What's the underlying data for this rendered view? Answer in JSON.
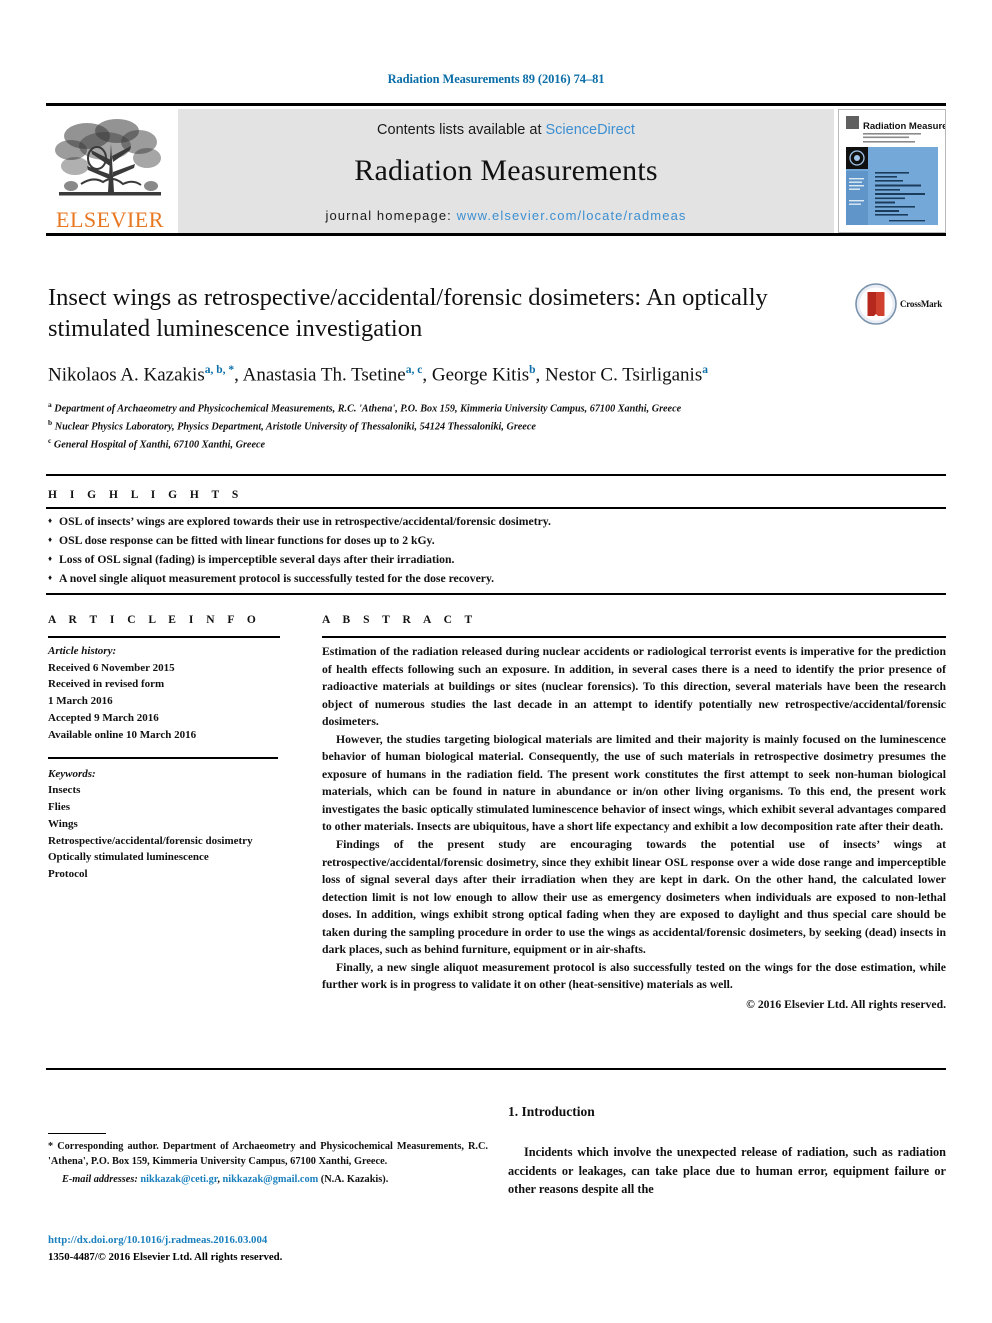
{
  "running_head": "Radiation Measurements 89 (2016) 74–81",
  "masthead": {
    "contents_prefix": "Contents lists available at ",
    "sciencedirect": "ScienceDirect",
    "journal_name": "Radiation Measurements",
    "homepage_prefix": "journal homepage: ",
    "homepage_url": "www.elsevier.com/locate/radmeas",
    "publisher": "ELSEVIER",
    "publisher_color": "#E87722",
    "link_color": "#3d8fd1",
    "band_color": "#e3e3e3",
    "cover_title": "Radiation Measurements"
  },
  "article": {
    "title": "Insect wings as retrospective/accidental/forensic dosimeters: An optically stimulated luminescence investigation",
    "authors": [
      {
        "name": "Nikolaos A. Kazakis",
        "marks": "a, b, *"
      },
      {
        "name": "Anastasia Th. Tsetine",
        "marks": "a, c"
      },
      {
        "name": "George Kitis",
        "marks": "b"
      },
      {
        "name": "Nestor C. Tsirliganis",
        "marks": "a"
      }
    ],
    "affiliations": [
      {
        "mark": "a",
        "text": "Department of Archaeometry and Physicochemical Measurements, R.C. 'Athena', P.O. Box 159, Kimmeria University Campus, 67100 Xanthi, Greece"
      },
      {
        "mark": "b",
        "text": "Nuclear Physics Laboratory, Physics Department, Aristotle University of Thessaloniki, 54124 Thessaloniki, Greece"
      },
      {
        "mark": "c",
        "text": "General Hospital of Xanthi, 67100 Xanthi, Greece"
      }
    ]
  },
  "crossmark": {
    "label": "CrossMark"
  },
  "highlights": {
    "heading": "H I G H L I G H T S",
    "items": [
      "OSL of insects’ wings are explored towards their use in retrospective/accidental/forensic dosimetry.",
      "OSL dose response can be fitted with linear functions for doses up to 2 kGy.",
      "Loss of OSL signal (fading) is imperceptible several days after their irradiation.",
      "A novel single aliquot measurement protocol is successfully tested for the dose recovery."
    ]
  },
  "article_info": {
    "heading": "A R T I C L E   I N F O",
    "history_label": "Article history:",
    "history": [
      "Received 6 November 2015",
      "Received in revised form",
      "1 March 2016",
      "Accepted 9 March 2016",
      "Available online 10 March 2016"
    ],
    "keywords_label": "Keywords:",
    "keywords": [
      "Insects",
      "Flies",
      "Wings",
      "Retrospective/accidental/forensic dosimetry",
      "Optically stimulated luminescence",
      "Protocol"
    ]
  },
  "abstract": {
    "heading": "A B S T R A C T",
    "paragraphs": [
      "Estimation of the radiation released during nuclear accidents or radiological terrorist events is imperative for the prediction of health effects following such an exposure. In addition, in several cases there is a need to identify the prior presence of radioactive materials at buildings or sites (nuclear forensics). To this direction, several materials have been the research object of numerous studies the last decade in an attempt to identify potentially new retrospective/accidental/forensic dosimeters.",
      "However, the studies targeting biological materials are limited and their majority is mainly focused on the luminescence behavior of human biological material. Consequently, the use of such materials in retrospective dosimetry presumes the exposure of humans in the radiation field. The present work constitutes the first attempt to seek non-human biological materials, which can be found in nature in abundance or in/on other living organisms. To this end, the present work investigates the basic optically stimulated luminescence behavior of insect wings, which exhibit several advantages compared to other materials. Insects are ubiquitous, have a short life expectancy and exhibit a low decomposition rate after their death.",
      "Findings of the present study are encouraging towards the potential use of insects’ wings at retrospective/accidental/forensic dosimetry, since they exhibit linear OSL response over a wide dose range and imperceptible loss of signal several days after their irradiation when they are kept in dark. On the other hand, the calculated lower detection limit is not low enough to allow their use as emergency dosimeters when individuals are exposed to non-lethal doses. In addition, wings exhibit strong optical fading when they are exposed to daylight and thus special care should be taken during the sampling procedure in order to use the wings as accidental/forensic dosimeters, by seeking (dead) insects in dark places, such as behind furniture, equipment or in air-shafts.",
      "Finally, a new single aliquot measurement protocol is also successfully tested on the wings for the dose estimation, while further work is in progress to validate it on other (heat-sensitive) materials as well."
    ],
    "copyright": "© 2016 Elsevier Ltd. All rights reserved."
  },
  "footnote": {
    "star": "*",
    "corresponding": " Corresponding author. Department of Archaeometry and Physicochemical Measurements, R.C. 'Athena', P.O. Box 159, Kimmeria University Campus, 67100 Xanthi, Greece.",
    "email_label": "E-mail addresses:",
    "email1": "nikkazak@ceti.gr",
    "email2": "nikkazak@gmail.com",
    "email_suffix": " (N.A. Kazakis).",
    "link_color": "#1a7fbd"
  },
  "doi_block": {
    "doi": "http://dx.doi.org/10.1016/j.radmeas.2016.03.004",
    "issn_line": "1350-4487/© 2016 Elsevier Ltd. All rights reserved."
  },
  "introduction": {
    "heading": "1. Introduction",
    "paragraph": "Incidents which involve the unexpected release of radiation, such as radiation accidents or leakages, can take place due to human error, equipment failure or other reasons despite all the"
  }
}
